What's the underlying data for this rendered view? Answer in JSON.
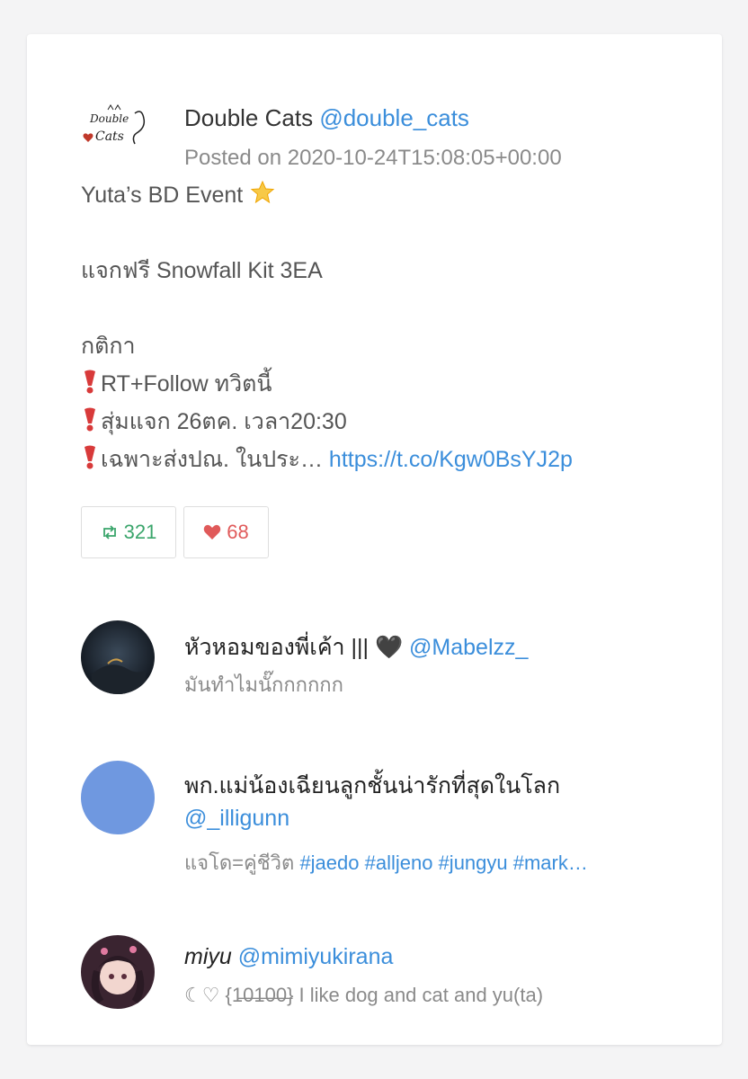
{
  "post": {
    "author_name": "Double Cats",
    "author_handle": "@double_cats",
    "posted": "Posted on 2020-10-24T15:08:05+00:00",
    "logo_text": "Double Cats",
    "lines": {
      "l1": "Yuta’s BD Event",
      "l2": "แจกฟรี Snowfall Kit 3EA",
      "l3": "กติกา",
      "l4": "RT+Follow ทวิตนี้",
      "l5": "สุ่มแจก 26ตค. เวลา20:30",
      "l6": "เฉพาะส่งปณ. ในประ…",
      "link": "https://t.co/Kgw0BsYJ2p"
    },
    "retweets": "321",
    "likes": "68"
  },
  "replies": [
    {
      "name": "หัวหอมของพี่เค้า ||| 🖤",
      "handle": "@Mabelzz_",
      "bio": "มันทำไมนั๊กกกกกก"
    },
    {
      "name": "พก.แม่น้องเฉียนลูกชั้นน่ารักที่สุดในโลก",
      "handle": "@_illigunn",
      "bio_text": "แจโด=คู่ชีวิต",
      "bio_tags": "#jaedo #alljeno #jungyu #mark…"
    },
    {
      "name": "miyu",
      "handle": "@mimiyukirana",
      "bio": "☾♡ {1̶0̶1̶0̶0̶} I like dog and cat and yu(ta)"
    }
  ],
  "colors": {
    "link": "#3b8edb",
    "retweet": "#3aa56b",
    "like": "#e05a5a",
    "muted": "#8a8a8a"
  },
  "icons": {
    "retweet": "retweet-icon",
    "like": "heart-icon",
    "emoji_star": "glowing-star-icon",
    "emoji_exclamation": "red-exclamation-icon"
  }
}
